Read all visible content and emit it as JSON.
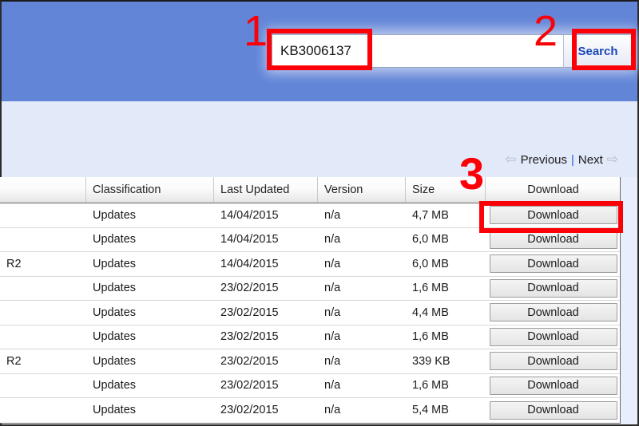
{
  "banner": {
    "background_color": "#6285d8"
  },
  "search": {
    "value": "KB3006137",
    "placeholder": "",
    "button_label": "Search",
    "button_text_color": "#1a46b8"
  },
  "annotations": {
    "color": "#fb0007",
    "markers": [
      {
        "number": "1",
        "target": "search-input"
      },
      {
        "number": "2",
        "target": "search-button"
      },
      {
        "number": "3",
        "target": "download-column"
      }
    ]
  },
  "pager": {
    "prev_arrow": "⇦",
    "previous_label": "Previous",
    "separator": "|",
    "next_label": "Next",
    "next_arrow": "⇨"
  },
  "table": {
    "columns": [
      {
        "key": "title",
        "label": ""
      },
      {
        "key": "classification",
        "label": "Classification"
      },
      {
        "key": "last_updated",
        "label": "Last Updated"
      },
      {
        "key": "version",
        "label": "Version"
      },
      {
        "key": "size",
        "label": "Size"
      },
      {
        "key": "download",
        "label": "Download"
      }
    ],
    "download_button_label": "Download",
    "rows": [
      {
        "title": "",
        "classification": "Updates",
        "last_updated": "14/04/2015",
        "version": "n/a",
        "size": "4,7 MB",
        "download": "Download"
      },
      {
        "title": "",
        "classification": "Updates",
        "last_updated": "14/04/2015",
        "version": "n/a",
        "size": "6,0 MB",
        "download": "Download"
      },
      {
        "title": "R2",
        "classification": "Updates",
        "last_updated": "14/04/2015",
        "version": "n/a",
        "size": "6,0 MB",
        "download": "Download"
      },
      {
        "title": "",
        "classification": "Updates",
        "last_updated": "23/02/2015",
        "version": "n/a",
        "size": "1,6 MB",
        "download": "Download"
      },
      {
        "title": "",
        "classification": "Updates",
        "last_updated": "23/02/2015",
        "version": "n/a",
        "size": "4,4 MB",
        "download": "Download"
      },
      {
        "title": "",
        "classification": "Updates",
        "last_updated": "23/02/2015",
        "version": "n/a",
        "size": "1,6 MB",
        "download": "Download"
      },
      {
        "title": "R2",
        "classification": "Updates",
        "last_updated": "23/02/2015",
        "version": "n/a",
        "size": "339 KB",
        "download": "Download"
      },
      {
        "title": "",
        "classification": "Updates",
        "last_updated": "23/02/2015",
        "version": "n/a",
        "size": "1,6 MB",
        "download": "Download"
      },
      {
        "title": "",
        "classification": "Updates",
        "last_updated": "23/02/2015",
        "version": "n/a",
        "size": "5,4 MB",
        "download": "Download"
      }
    ]
  }
}
